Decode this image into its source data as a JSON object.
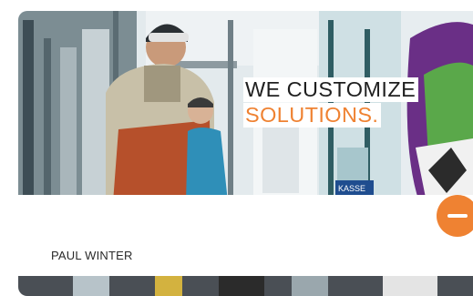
{
  "hero": {
    "headline_line1": "WE CUSTOMIZE",
    "headline_line2": "SOLUTIONS.",
    "sign_text": "KASSE"
  },
  "card": {
    "author": "PAUL WINTER"
  },
  "colors": {
    "accent": "#ef8232",
    "headline_text": "#1f1f1f",
    "panel": "#ffffff"
  },
  "icons": {
    "fab": "plus-icon"
  }
}
